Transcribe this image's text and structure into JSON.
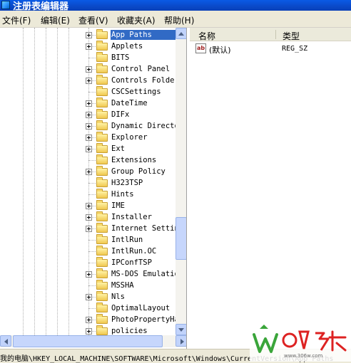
{
  "window": {
    "title": "注册表编辑器"
  },
  "menu": [
    {
      "label": "文件(F)"
    },
    {
      "label": "编辑(E)"
    },
    {
      "label": "查看(V)"
    },
    {
      "label": "收藏夹(A)"
    },
    {
      "label": "帮助(H)"
    }
  ],
  "tree": {
    "items": [
      {
        "label": "App Paths",
        "expandable": true,
        "selected": true
      },
      {
        "label": "Applets",
        "expandable": true
      },
      {
        "label": "BITS",
        "expandable": false
      },
      {
        "label": "Control Panel",
        "expandable": true
      },
      {
        "label": "Controls Folder",
        "expandable": true
      },
      {
        "label": "CSCSettings",
        "expandable": false
      },
      {
        "label": "DateTime",
        "expandable": true
      },
      {
        "label": "DIFx",
        "expandable": true
      },
      {
        "label": "Dynamic Directory",
        "expandable": true
      },
      {
        "label": "Explorer",
        "expandable": true
      },
      {
        "label": "Ext",
        "expandable": true
      },
      {
        "label": "Extensions",
        "expandable": false
      },
      {
        "label": "Group Policy",
        "expandable": true
      },
      {
        "label": "H323TSP",
        "expandable": false
      },
      {
        "label": "Hints",
        "expandable": false
      },
      {
        "label": "IME",
        "expandable": true
      },
      {
        "label": "Installer",
        "expandable": true
      },
      {
        "label": "Internet Settings",
        "expandable": true
      },
      {
        "label": "IntlRun",
        "expandable": false
      },
      {
        "label": "IntlRun.OC",
        "expandable": false
      },
      {
        "label": "IPConfTSP",
        "expandable": false
      },
      {
        "label": "MS-DOS Emulation",
        "expandable": true
      },
      {
        "label": "MSSHA",
        "expandable": false
      },
      {
        "label": "Nls",
        "expandable": true
      },
      {
        "label": "OptimalLayout",
        "expandable": false
      },
      {
        "label": "PhotoPropertyHandler",
        "expandable": true
      },
      {
        "label": "policies",
        "expandable": true
      }
    ]
  },
  "list": {
    "columns": [
      "名称",
      "类型"
    ],
    "rows": [
      {
        "name": "(默认)",
        "type": "REG_SZ",
        "icon": "string-value-icon",
        "icon_text": "ab"
      }
    ]
  },
  "status": {
    "path": "我的电脑\\HKEY_LOCAL_MACHINE\\SOFTWARE\\Microsoft\\Windows\\CurrentVersion\\App Paths"
  },
  "watermark": {
    "site": "www.306w.com"
  },
  "colors": {
    "title_bar": "#0a49c8",
    "selection": "#316ac5",
    "folder": "#f0c850"
  }
}
